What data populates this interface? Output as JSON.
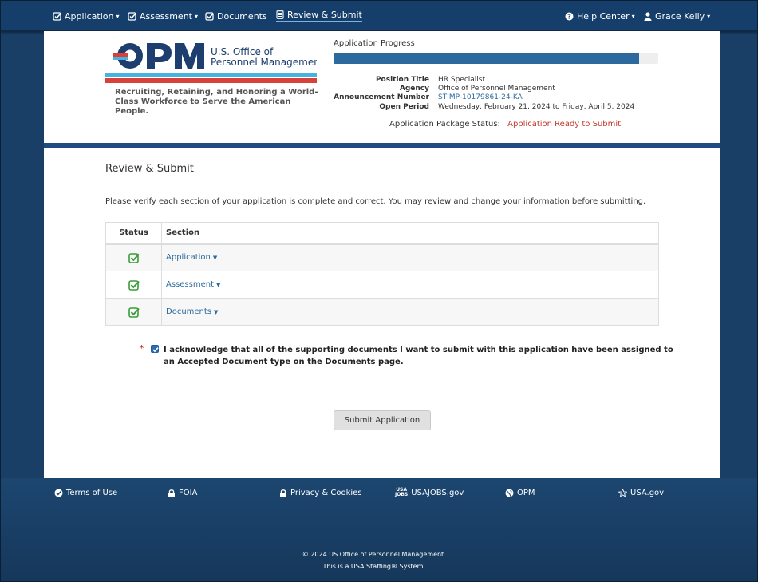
{
  "nav": {
    "application": "Application",
    "assessment": "Assessment",
    "documents": "Documents",
    "review_submit": "Review & Submit",
    "help_center": "Help Center",
    "user_name": "Grace Kelly"
  },
  "header": {
    "logo_text": "OPM",
    "logo_org": "U.S. Office of Personnel Management",
    "logo_org_line1": "U.S. Office of",
    "logo_org_line2": "Personnel Management",
    "tagline": "Recruiting, Retaining, and Honoring a World-Class Workforce to Serve the American People.",
    "progress_label": "Application Progress",
    "progress_percent": 94,
    "position_title_label": "Position Title",
    "position_title": "HR Specialist",
    "agency_label": "Agency",
    "agency": "Office of Personnel Management",
    "announcement_label": "Announcement Number",
    "announcement": "STIMP-10179861-24-KA",
    "open_period_label": "Open Period",
    "open_period": "Wednesday, February 21, 2024 to Friday, April 5, 2024",
    "package_status_label": "Application Package Status:",
    "package_status": "Application Ready to Submit"
  },
  "main": {
    "heading": "Review & Submit",
    "intro": "Please verify each section of your application is complete and correct. You may review and change your information before submitting.",
    "table": {
      "col_status": "Status",
      "col_section": "Section",
      "rows": [
        {
          "section": "Application",
          "status_icon": "check-square-icon"
        },
        {
          "section": "Assessment",
          "status_icon": "check-square-icon"
        },
        {
          "section": "Documents",
          "status_icon": "check-square-icon"
        }
      ]
    },
    "acknowledge_required": "*",
    "acknowledge_text": "I acknowledge that all of the supporting documents I want to submit with this application have been assigned to an Accepted Document type on the Documents page.",
    "acknowledge_checked": true,
    "submit_label": "Submit Application"
  },
  "footer": {
    "terms": "Terms of Use",
    "foia": "FOIA",
    "privacy": "Privacy & Cookies",
    "usajobs_logo_top": "USA",
    "usajobs_logo_bottom": "JOBS",
    "usajobs": "USAJOBS.gov",
    "opm": "OPM",
    "usagov": "USA.gov",
    "copyright": "© 2024 US Office of Personnel Management",
    "system": "This is a USA Staffing® System"
  },
  "colors": {
    "nav_bg": "#153e6a",
    "accent_blue": "#2c6a9e",
    "status_red": "#c0392b",
    "check_green": "#3a9d3a"
  }
}
